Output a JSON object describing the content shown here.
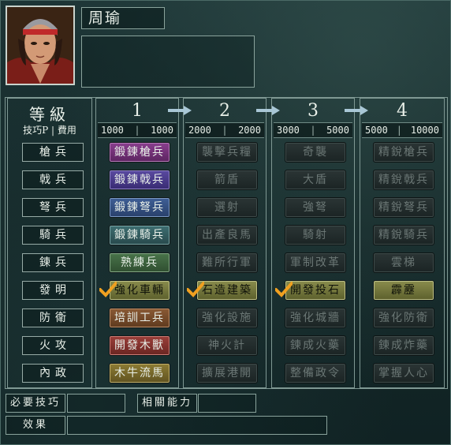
{
  "officer": {
    "name": "周瑜"
  },
  "header": {
    "title": "等級",
    "subtitle": "技巧P | 費用"
  },
  "levels": [
    {
      "num": "1",
      "cost_a": "1000",
      "cost_b": "1000"
    },
    {
      "num": "2",
      "cost_a": "2000",
      "cost_b": "2000"
    },
    {
      "num": "3",
      "cost_a": "3000",
      "cost_b": "5000"
    },
    {
      "num": "4",
      "cost_a": "5000",
      "cost_b": "10000"
    }
  ],
  "rows": [
    {
      "label": "槍兵",
      "skills": [
        "鍛鍊槍兵",
        "襲擊兵糧",
        "奇襲",
        "精銳槍兵"
      ]
    },
    {
      "label": "戟兵",
      "skills": [
        "鍛鍊戟兵",
        "箭盾",
        "大盾",
        "精銳戟兵"
      ]
    },
    {
      "label": "弩兵",
      "skills": [
        "鍛鍊弩兵",
        "選射",
        "強弩",
        "精銳弩兵"
      ]
    },
    {
      "label": "騎兵",
      "skills": [
        "鍛鍊騎兵",
        "出產良馬",
        "騎射",
        "精銳騎兵"
      ]
    },
    {
      "label": "鍊兵",
      "skills": [
        "熟練兵",
        "難所行軍",
        "軍制改革",
        "雲梯"
      ]
    },
    {
      "label": "發明",
      "skills": [
        "強化車輛",
        "石造建築",
        "開發投石",
        "霹靂"
      ]
    },
    {
      "label": "防衛",
      "skills": [
        "培訓工兵",
        "強化設施",
        "強化城牆",
        "強化防衛"
      ]
    },
    {
      "label": "火攻",
      "skills": [
        "開發木獸",
        "神火計",
        "鍊成火藥",
        "鍊成炸藥"
      ]
    },
    {
      "label": "內政",
      "skills": [
        "木牛流馬",
        "擴展港開",
        "整備政令",
        "掌握人心"
      ]
    }
  ],
  "footer": {
    "required_label": "必要技巧",
    "related_label": "相關能力",
    "effect_label": "效果"
  },
  "colors": {
    "background": "#15292a",
    "border": "#7f9893",
    "check": "#f0a020"
  }
}
